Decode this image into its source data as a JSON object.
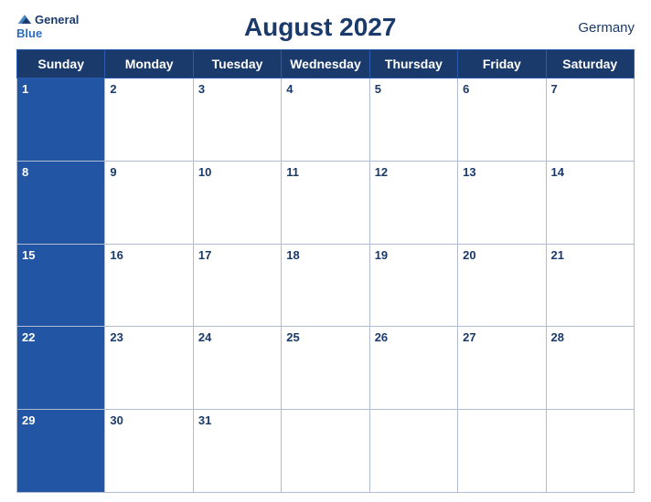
{
  "header": {
    "logo_general": "General",
    "logo_blue": "Blue",
    "title": "August 2027",
    "country": "Germany"
  },
  "weekdays": [
    "Sunday",
    "Monday",
    "Tuesday",
    "Wednesday",
    "Thursday",
    "Friday",
    "Saturday"
  ],
  "weeks": [
    [
      1,
      2,
      3,
      4,
      5,
      6,
      7
    ],
    [
      8,
      9,
      10,
      11,
      12,
      13,
      14
    ],
    [
      15,
      16,
      17,
      18,
      19,
      20,
      21
    ],
    [
      22,
      23,
      24,
      25,
      26,
      27,
      28
    ],
    [
      29,
      30,
      31,
      null,
      null,
      null,
      null
    ]
  ]
}
